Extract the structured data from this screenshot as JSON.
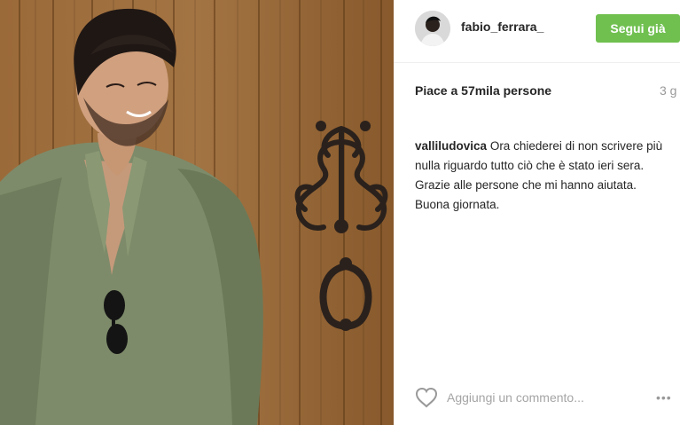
{
  "post": {
    "photo_alt": "",
    "author": {
      "username": "fabio_ferrara_",
      "avatar_icon": "profile-photo"
    },
    "follow_label": "Segui già",
    "likes": "Piace a 57mila persone",
    "time": "3 g",
    "comment": {
      "username": "valliludovica",
      "text": "Ora chiederei di non scrivere più nulla riguardo tutto ciò che è stato ieri sera. Grazie alle persone che mi hanno aiutata. Buona giornata."
    },
    "add_comment_placeholder": "Aggiungi un commento...",
    "more_icon": "ellipsis-icon",
    "like_icon": "heart-icon",
    "colors": {
      "follow_button": "#70c050",
      "muted": "#999999",
      "text": "#262626"
    }
  }
}
